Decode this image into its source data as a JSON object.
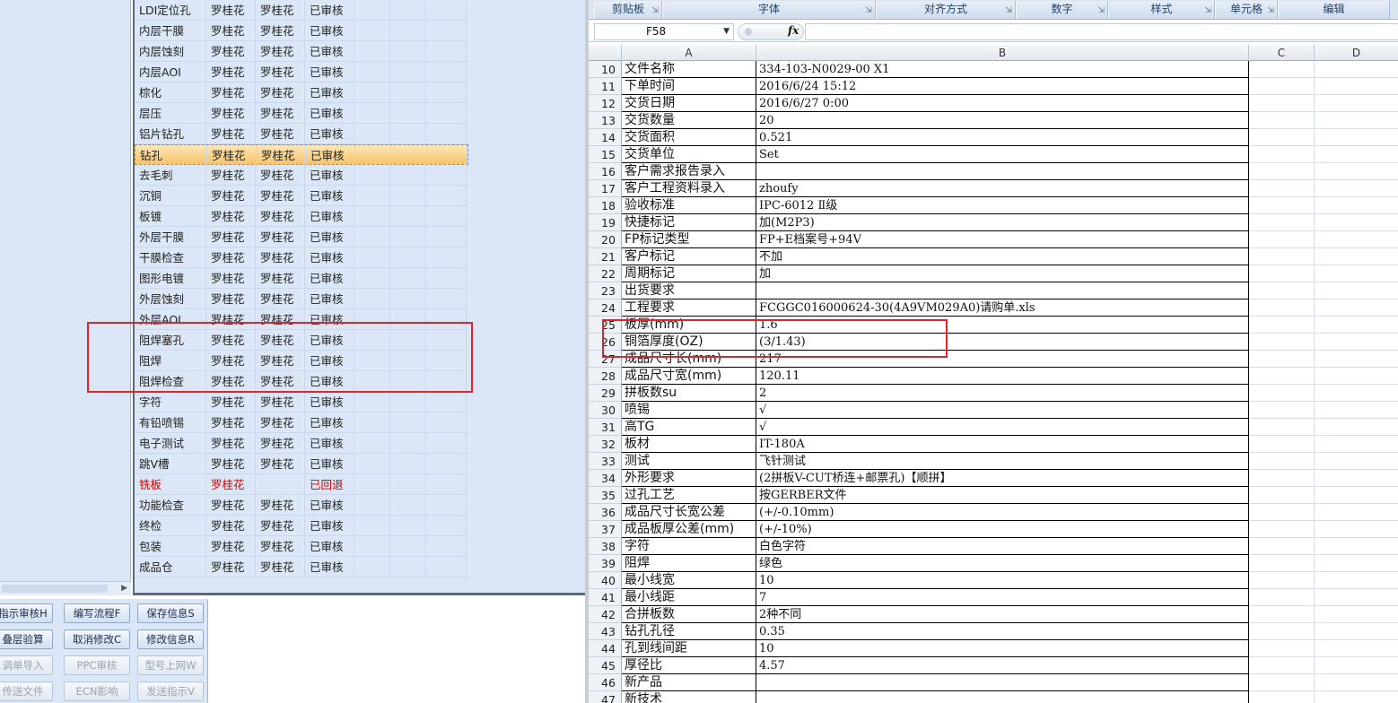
{
  "colors": {
    "accent": "#e0242b",
    "selected": "#f7c36b",
    "returned": "#d20000",
    "nav_bg": "#dbe7f6"
  },
  "process_grid": {
    "rows": [
      {
        "name": "LDI定位孔",
        "p1": "罗桂花",
        "p2": "罗桂花",
        "status": "已审核"
      },
      {
        "name": "内层干膜",
        "p1": "罗桂花",
        "p2": "罗桂花",
        "status": "已审核"
      },
      {
        "name": "内层蚀刻",
        "p1": "罗桂花",
        "p2": "罗桂花",
        "status": "已审核"
      },
      {
        "name": "内层AOI",
        "p1": "罗桂花",
        "p2": "罗桂花",
        "status": "已审核"
      },
      {
        "name": "棕化",
        "p1": "罗桂花",
        "p2": "罗桂花",
        "status": "已审核"
      },
      {
        "name": "层压",
        "p1": "罗桂花",
        "p2": "罗桂花",
        "status": "已审核"
      },
      {
        "name": "铝片钻孔",
        "p1": "罗桂花",
        "p2": "罗桂花",
        "status": "已审核"
      },
      {
        "name": "钻孔",
        "p1": "罗桂花",
        "p2": "罗桂花",
        "status": "已审核",
        "selected": true
      },
      {
        "name": "去毛刺",
        "p1": "罗桂花",
        "p2": "罗桂花",
        "status": "已审核"
      },
      {
        "name": "沉铜",
        "p1": "罗桂花",
        "p2": "罗桂花",
        "status": "已审核"
      },
      {
        "name": "板镀",
        "p1": "罗桂花",
        "p2": "罗桂花",
        "status": "已审核"
      },
      {
        "name": "外层干膜",
        "p1": "罗桂花",
        "p2": "罗桂花",
        "status": "已审核"
      },
      {
        "name": "干膜检查",
        "p1": "罗桂花",
        "p2": "罗桂花",
        "status": "已审核"
      },
      {
        "name": "图形电镀",
        "p1": "罗桂花",
        "p2": "罗桂花",
        "status": "已审核"
      },
      {
        "name": "外层蚀刻",
        "p1": "罗桂花",
        "p2": "罗桂花",
        "status": "已审核"
      },
      {
        "name": "外层AOI",
        "p1": "罗桂花",
        "p2": "罗桂花",
        "status": "已审核"
      },
      {
        "name": "阻焊塞孔",
        "p1": "罗桂花",
        "p2": "罗桂花",
        "status": "已审核"
      },
      {
        "name": "阻焊",
        "p1": "罗桂花",
        "p2": "罗桂花",
        "status": "已审核"
      },
      {
        "name": "阻焊检查",
        "p1": "罗桂花",
        "p2": "罗桂花",
        "status": "已审核"
      },
      {
        "name": "字符",
        "p1": "罗桂花",
        "p2": "罗桂花",
        "status": "已审核"
      },
      {
        "name": "有铅喷锡",
        "p1": "罗桂花",
        "p2": "罗桂花",
        "status": "已审核"
      },
      {
        "name": "电子测试",
        "p1": "罗桂花",
        "p2": "罗桂花",
        "status": "已审核"
      },
      {
        "name": "跳V槽",
        "p1": "罗桂花",
        "p2": "罗桂花",
        "status": "已审核"
      },
      {
        "name": "铣板",
        "p1": "罗桂花",
        "p2": "",
        "status": "已回退",
        "returned": true
      },
      {
        "name": "功能检查",
        "p1": "罗桂花",
        "p2": "罗桂花",
        "status": "已审核"
      },
      {
        "name": "终检",
        "p1": "罗桂花",
        "p2": "罗桂花",
        "status": "已审核"
      },
      {
        "name": "包装",
        "p1": "罗桂花",
        "p2": "罗桂花",
        "status": "已审核"
      },
      {
        "name": "成品仓",
        "p1": "罗桂花",
        "p2": "罗桂花",
        "status": "已审核"
      }
    ]
  },
  "buttons": [
    {
      "label": "指示审核H",
      "enabled": true
    },
    {
      "label": "编写流程F",
      "enabled": true
    },
    {
      "label": "保存信息S",
      "enabled": true
    },
    {
      "label": "叠层验算",
      "enabled": true
    },
    {
      "label": "取消修改C",
      "enabled": true
    },
    {
      "label": "修改信息R",
      "enabled": true
    },
    {
      "label": "调单导入",
      "enabled": false
    },
    {
      "label": "PPC审核",
      "enabled": false
    },
    {
      "label": "型号上网W",
      "enabled": false
    },
    {
      "label": "传送文件",
      "enabled": false
    },
    {
      "label": "ECN影响",
      "enabled": false
    },
    {
      "label": "发送指示V",
      "enabled": false
    }
  ],
  "ribbon": {
    "groups": [
      "剪贴板",
      "字体",
      "对齐方式",
      "数字",
      "样式",
      "单元格",
      "编辑"
    ]
  },
  "formula_bar": {
    "name_box": "F58",
    "fx": "fx",
    "formula": ""
  },
  "sheet": {
    "columns": [
      "A",
      "B",
      "C",
      "D"
    ],
    "rows": [
      {
        "n": "10",
        "a": "文件名称",
        "b": "334-103-N0029-00 X1"
      },
      {
        "n": "11",
        "a": "下单时间",
        "b": "2016/6/24 15:12"
      },
      {
        "n": "12",
        "a": "交货日期",
        "b": "2016/6/27 0:00"
      },
      {
        "n": "13",
        "a": "交货数量",
        "b": "20"
      },
      {
        "n": "14",
        "a": "交货面积",
        "b": "0.521"
      },
      {
        "n": "15",
        "a": "交货单位",
        "b": "Set"
      },
      {
        "n": "16",
        "a": "客户需求报告录入",
        "b": ""
      },
      {
        "n": "17",
        "a": "客户工程资料录入",
        "b": "zhoufy"
      },
      {
        "n": "18",
        "a": "验收标准",
        "b": "IPC-6012 Ⅱ级"
      },
      {
        "n": "19",
        "a": "快捷标记",
        "b": "加(M2P3)"
      },
      {
        "n": "20",
        "a": "FP标记类型",
        "b": "FP+E档案号+94V"
      },
      {
        "n": "21",
        "a": "客户标记",
        "b": "不加"
      },
      {
        "n": "22",
        "a": "周期标记",
        "b": "加"
      },
      {
        "n": "23",
        "a": "出货要求",
        "b": ""
      },
      {
        "n": "24",
        "a": "工程要求",
        "b": "FCGGC016000624-30(4A9VM029A0)请购单.xls"
      },
      {
        "n": "25",
        "a": "板厚(mm)",
        "b": "1.6"
      },
      {
        "n": "26",
        "a": "铜箔厚度(OZ)",
        "b": " (3/1.43)"
      },
      {
        "n": "27",
        "a": "成品尺寸长(mm)",
        "b": "217"
      },
      {
        "n": "28",
        "a": "成品尺寸宽(mm)",
        "b": "120.11"
      },
      {
        "n": "29",
        "a": "拼板数su",
        "b": "2"
      },
      {
        "n": "30",
        "a": "喷锡",
        "b": "√"
      },
      {
        "n": "31",
        "a": "高TG",
        "b": "√"
      },
      {
        "n": "32",
        "a": "板材",
        "b": "IT-180A"
      },
      {
        "n": "33",
        "a": "测试",
        "b": "飞针测试"
      },
      {
        "n": "34",
        "a": "外形要求",
        "b": "(2拼板V-CUT桥连+邮票孔)【顺拼】"
      },
      {
        "n": "35",
        "a": "过孔工艺",
        "b": "按GERBER文件"
      },
      {
        "n": "36",
        "a": "成品尺寸长宽公差",
        "b": "(+/-0.10mm)"
      },
      {
        "n": "37",
        "a": "成品板厚公差(mm)",
        "b": "(+/-10%)"
      },
      {
        "n": "38",
        "a": "字符",
        "b": "白色字符"
      },
      {
        "n": "39",
        "a": "阻焊",
        "b": "绿色"
      },
      {
        "n": "40",
        "a": "最小线宽",
        "b": "10"
      },
      {
        "n": "41",
        "a": "最小线距",
        "b": "7"
      },
      {
        "n": "42",
        "a": "合拼板数",
        "b": "2种不同"
      },
      {
        "n": "43",
        "a": "钻孔孔径",
        "b": "0.35"
      },
      {
        "n": "44",
        "a": "孔到线间距",
        "b": "10"
      },
      {
        "n": "45",
        "a": "厚径比",
        "b": "4.57"
      },
      {
        "n": "46",
        "a": "新产品",
        "b": ""
      },
      {
        "n": "47",
        "a": "新技术",
        "b": ""
      }
    ]
  }
}
